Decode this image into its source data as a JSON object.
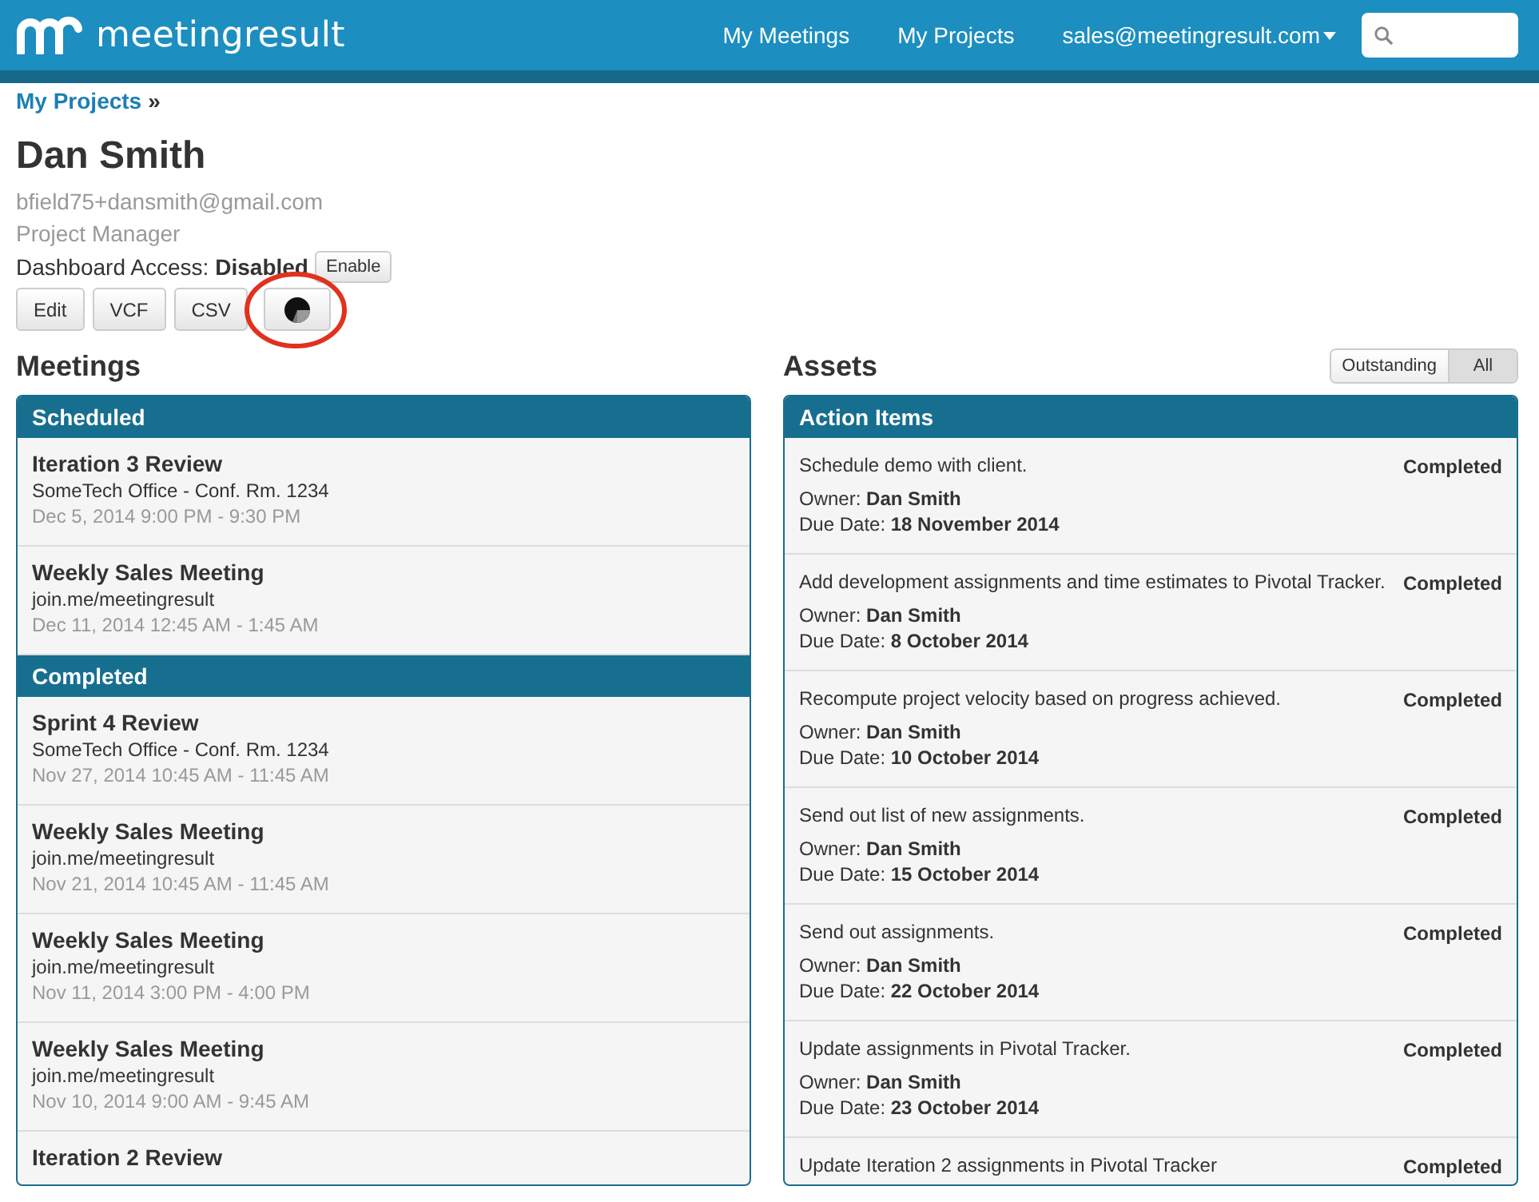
{
  "nav": {
    "brand": "meetingresult",
    "links": [
      {
        "label": "My Meetings"
      },
      {
        "label": "My Projects"
      }
    ],
    "account": "sales@meetingresult.com"
  },
  "breadcrumb": {
    "link": "My Projects",
    "separator": "»"
  },
  "person": {
    "name": "Dan Smith",
    "email": "bfield75+dansmith@gmail.com",
    "role": "Project Manager",
    "access_label": "Dashboard Access:",
    "access_value": "Disabled",
    "access_button": "Enable",
    "buttons": [
      {
        "kind": "text",
        "label": "Edit"
      },
      {
        "kind": "text",
        "label": "VCF"
      },
      {
        "kind": "text",
        "label": "CSV"
      },
      {
        "kind": "chart",
        "highlighted": true
      }
    ]
  },
  "meetings": {
    "title": "Meetings",
    "groups": [
      {
        "heading": "Scheduled",
        "items": [
          {
            "title": "Iteration 3 Review",
            "location": "SomeTech Office - Conf. Rm. 1234",
            "time": "Dec 5, 2014 9:00 PM - 9:30 PM"
          },
          {
            "title": "Weekly Sales Meeting",
            "location": "join.me/meetingresult",
            "time": "Dec 11, 2014 12:45 AM - 1:45 AM"
          }
        ]
      },
      {
        "heading": "Completed",
        "items": [
          {
            "title": "Sprint 4 Review",
            "location": "SomeTech Office - Conf. Rm. 1234",
            "time": "Nov 27, 2014 10:45 AM - 11:45 AM"
          },
          {
            "title": "Weekly Sales Meeting",
            "location": "join.me/meetingresult",
            "time": "Nov 21, 2014 10:45 AM - 11:45 AM"
          },
          {
            "title": "Weekly Sales Meeting",
            "location": "join.me/meetingresult",
            "time": "Nov 11, 2014 3:00 PM - 4:00 PM"
          },
          {
            "title": "Weekly Sales Meeting",
            "location": "join.me/meetingresult",
            "time": "Nov 10, 2014 9:00 AM - 9:45 AM"
          },
          {
            "title": "Iteration 2 Review"
          }
        ]
      }
    ]
  },
  "assets": {
    "title": "Assets",
    "filters": [
      {
        "label": "Outstanding",
        "selected": false
      },
      {
        "label": "All",
        "selected": true
      }
    ],
    "panel_title": "Action Items",
    "items": [
      {
        "text": "Schedule demo with client.",
        "status": "Completed",
        "owner_label": "Owner:",
        "owner": "Dan Smith",
        "due_label": "Due Date:",
        "due": "18 November 2014"
      },
      {
        "text": "Add development assignments and time estimates to Pivotal Tracker.",
        "status": "Completed",
        "owner_label": "Owner:",
        "owner": "Dan Smith",
        "due_label": "Due Date:",
        "due": "8 October 2014"
      },
      {
        "text": "Recompute project velocity based on progress achieved.",
        "status": "Completed",
        "owner_label": "Owner:",
        "owner": "Dan Smith",
        "due_label": "Due Date:",
        "due": "10 October 2014"
      },
      {
        "text": "Send out list of new assignments.",
        "status": "Completed",
        "owner_label": "Owner:",
        "owner": "Dan Smith",
        "due_label": "Due Date:",
        "due": "15 October 2014"
      },
      {
        "text": "Send out assignments.",
        "status": "Completed",
        "owner_label": "Owner:",
        "owner": "Dan Smith",
        "due_label": "Due Date:",
        "due": "22 October 2014"
      },
      {
        "text": "Update assignments in Pivotal Tracker.",
        "status": "Completed",
        "owner_label": "Owner:",
        "owner": "Dan Smith",
        "due_label": "Due Date:",
        "due": "23 October 2014"
      },
      {
        "text": "Update Iteration 2 assignments in Pivotal Tracker",
        "status": "Completed"
      }
    ]
  }
}
